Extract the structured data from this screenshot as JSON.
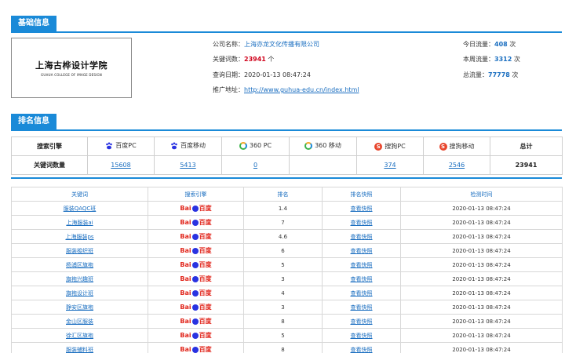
{
  "basic": {
    "section_title": "基础信息",
    "logo_cn": "上海古桦设计学院",
    "logo_en": "GUHUA COLLEGE OF IMAGE DESIGN",
    "company_label": "公司名称：",
    "company_value": "上海亦龙文化传播有限公司",
    "keywords_label": "关键词数：",
    "keywords_value": "23941",
    "keywords_unit": "个",
    "query_label": "查询日期：",
    "query_value": "2020-01-13 08:47:24",
    "url_label": "推广地址：",
    "url_value": "http://www.guhua-edu.cn/index.html",
    "today_label": "今日流量：",
    "today_value": "408",
    "week_label": "本周流量：",
    "week_value": "3312",
    "total_label": "总流量：",
    "total_value": "77778",
    "unit_ci": "次"
  },
  "ranking": {
    "section_title": "排名信息",
    "row1_label": "搜索引擎",
    "engines": [
      "百度PC",
      "百度移动",
      "360 PC",
      "360 移动",
      "搜狗PC",
      "搜狗移动"
    ],
    "total_label": "总计",
    "row2_label": "关键词数量",
    "counts": [
      "15608",
      "5413",
      "0",
      "",
      "374",
      "2546"
    ],
    "total_value": "23941"
  },
  "kw_table": {
    "headers": [
      "关键词",
      "搜索引擎",
      "排名",
      "排名快照",
      "检测时间"
    ],
    "rows": [
      {
        "keyword": "服装QAQC班",
        "rank": "1.4",
        "snapshot": "查看快照",
        "time": "2020-01-13 08:47:24"
      },
      {
        "keyword": "上海服装ai",
        "rank": "7",
        "snapshot": "查看快照",
        "time": "2020-01-13 08:47:24"
      },
      {
        "keyword": "上海服装ps",
        "rank": "4.6",
        "snapshot": "查看快照",
        "time": "2020-01-13 08:47:24"
      },
      {
        "keyword": "服装梭织班",
        "rank": "6",
        "snapshot": "查看快照",
        "time": "2020-01-13 08:47:24"
      },
      {
        "keyword": "杨浦区旗袍",
        "rank": "5",
        "snapshot": "查看快照",
        "time": "2020-01-13 08:47:24"
      },
      {
        "keyword": "旗袍兴趣班",
        "rank": "3",
        "snapshot": "查看快照",
        "time": "2020-01-13 08:47:24"
      },
      {
        "keyword": "旗袍设计班",
        "rank": "4",
        "snapshot": "查看快照",
        "time": "2020-01-13 08:47:24"
      },
      {
        "keyword": "静安区旗袍",
        "rank": "3",
        "snapshot": "查看快照",
        "time": "2020-01-13 08:47:24"
      },
      {
        "keyword": "金山区服装",
        "rank": "8",
        "snapshot": "查看快照",
        "time": "2020-01-13 08:47:24"
      },
      {
        "keyword": "徐汇区旗袍",
        "rank": "5",
        "snapshot": "查看快照",
        "time": "2020-01-13 08:47:24"
      },
      {
        "keyword": "服装辅料班",
        "rank": "8",
        "snapshot": "查看快照",
        "time": "2020-01-13 08:47:24"
      }
    ],
    "engine_logo_text_bai": "Bai",
    "engine_logo_text_du": "百度"
  },
  "colors": {
    "accent": "#1a8ad8",
    "link": "#1a6ec0",
    "highlight_red": "#d0021b"
  }
}
